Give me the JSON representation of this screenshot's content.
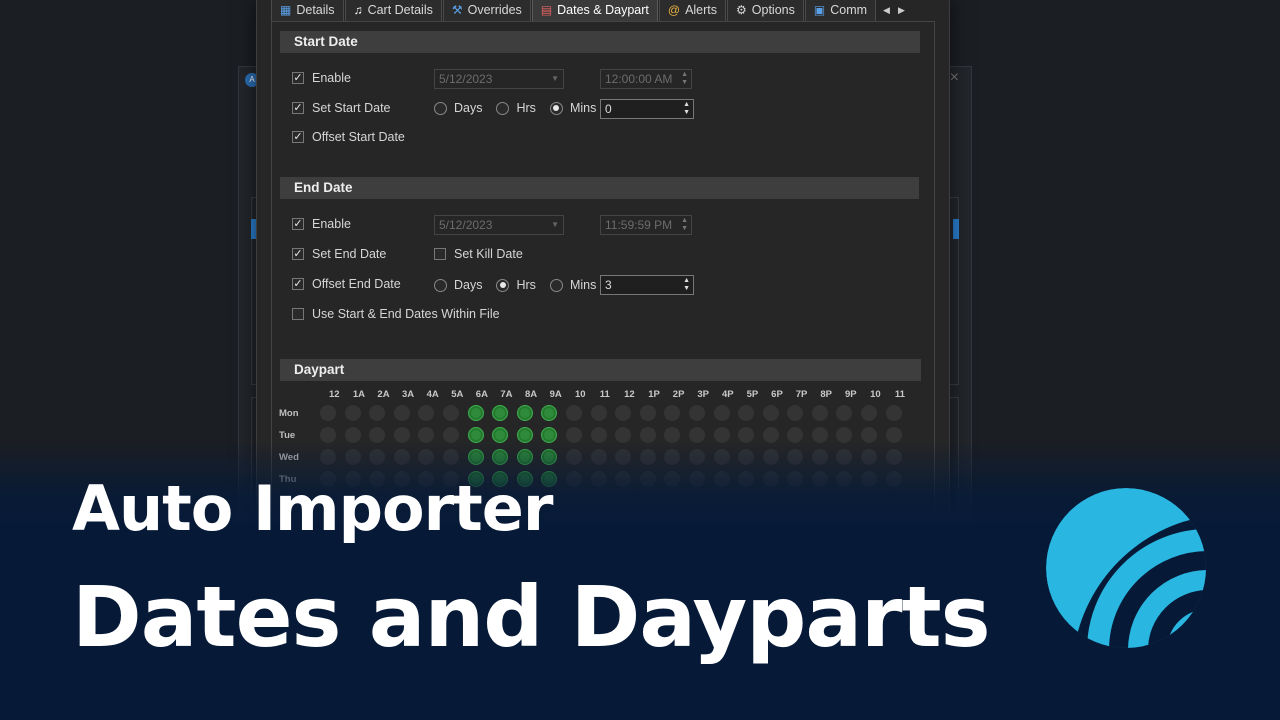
{
  "tabs": [
    {
      "label": "Details",
      "icon": "grid-icon"
    },
    {
      "label": "Cart Details",
      "icon": "music-note-icon"
    },
    {
      "label": "Overrides",
      "icon": "wrench-icon"
    },
    {
      "label": "Dates & Daypart",
      "icon": "calendar-icon",
      "active": true
    },
    {
      "label": "Alerts",
      "icon": "at-icon"
    },
    {
      "label": "Options",
      "icon": "gear-icon"
    },
    {
      "label": "Comm",
      "icon": "terminal-icon"
    }
  ],
  "start_date": {
    "heading": "Start Date",
    "enable_label": "Enable",
    "enable_checked": true,
    "date_value": "5/12/2023",
    "time_value": "12:00:00 AM",
    "set_start_label": "Set Start Date",
    "set_start_checked": true,
    "offset_label": "Offset Start Date",
    "offset_checked": true,
    "units": [
      "Days",
      "Hrs",
      "Mins"
    ],
    "unit_selected": "Mins",
    "offset_value": "0"
  },
  "end_date": {
    "heading": "End Date",
    "enable_label": "Enable",
    "enable_checked": true,
    "date_value": "5/12/2023",
    "time_value": "11:59:59 PM",
    "set_end_label": "Set End Date",
    "set_end_checked": true,
    "set_kill_label": "Set Kill Date",
    "set_kill_checked": false,
    "offset_label": "Offset End Date",
    "offset_checked": true,
    "units": [
      "Days",
      "Hrs",
      "Mins"
    ],
    "unit_selected": "Hrs",
    "offset_value": "3",
    "within_file_label": "Use Start & End Dates Within File",
    "within_file_checked": false
  },
  "daypart": {
    "heading": "Daypart",
    "hours": [
      "12",
      "1A",
      "2A",
      "3A",
      "4A",
      "5A",
      "6A",
      "7A",
      "8A",
      "9A",
      "10",
      "11",
      "12",
      "1P",
      "2P",
      "3P",
      "4P",
      "5P",
      "6P",
      "7P",
      "8P",
      "9P",
      "10",
      "11"
    ],
    "days": [
      "Mon",
      "Tue",
      "Wed",
      "Thu"
    ],
    "active_hours": [
      6,
      7,
      8,
      9
    ]
  },
  "overlay": {
    "title": "Auto Importer",
    "subtitle": "Dates and Dayparts"
  },
  "colors": {
    "overlay_bg": "#061a38",
    "logo": "#29b6e0",
    "active_dot": "#2e8b3a"
  }
}
